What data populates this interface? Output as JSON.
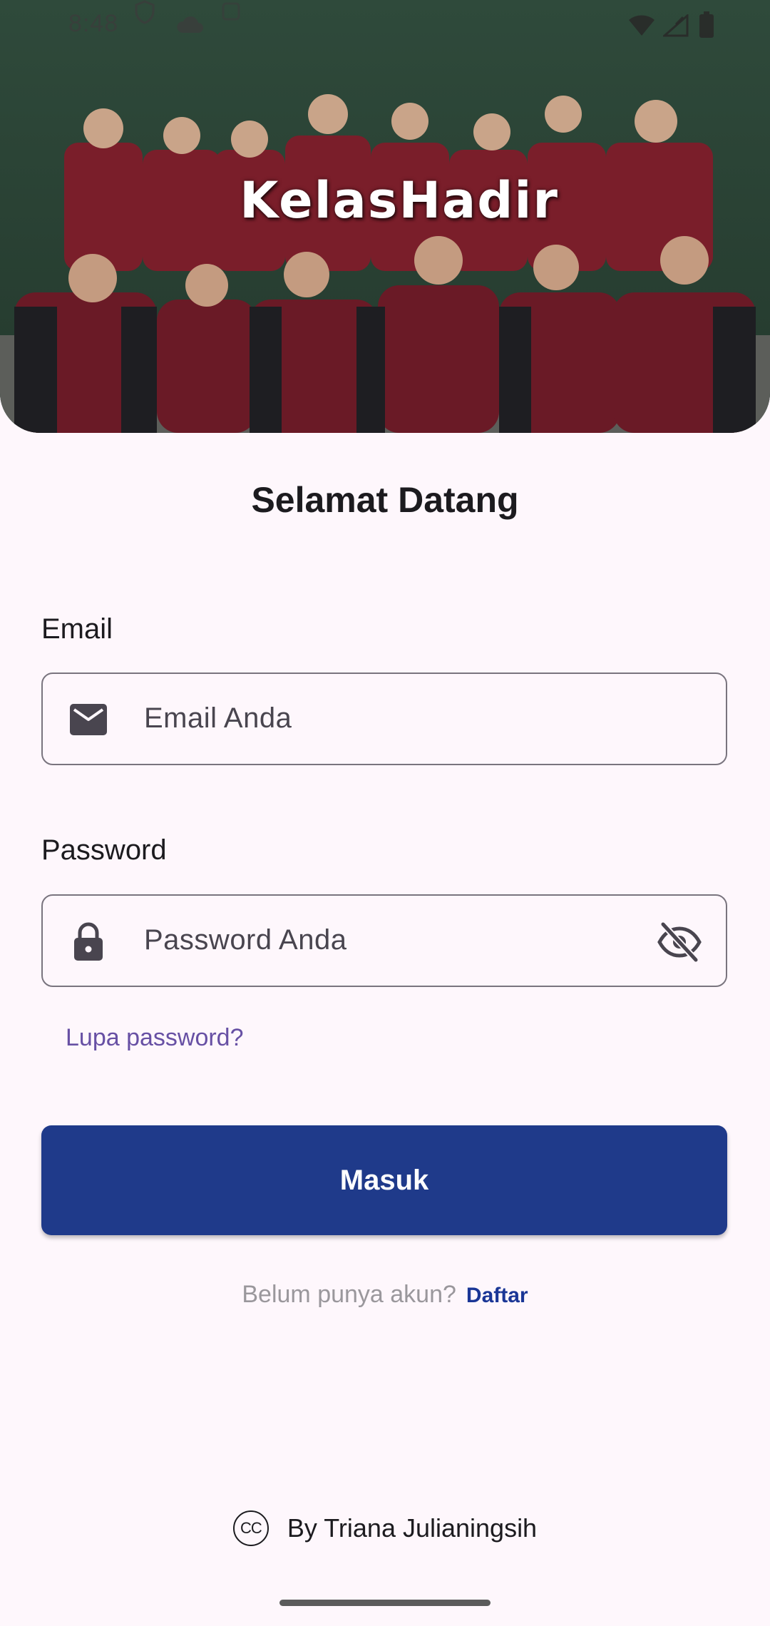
{
  "status_bar": {
    "time": "8:48"
  },
  "hero": {
    "brand": "KelasHadir"
  },
  "form": {
    "title": "Selamat Datang",
    "email": {
      "label": "Email",
      "placeholder": "Email Anda",
      "icon": "mail-icon"
    },
    "password": {
      "label": "Password",
      "placeholder": "Password Anda",
      "icon": "lock-icon",
      "toggle_icon": "visibility-off-icon"
    },
    "forgot_link": "Lupa password?",
    "submit_label": "Masuk",
    "signup_prompt": "Belum punya akun?",
    "signup_link": "Daftar"
  },
  "footer": {
    "cc_symbol": "CC",
    "credit": "By Triana Julianingsih"
  },
  "colors": {
    "background": "#fef7fc",
    "primary_button": "#1f3a8a",
    "link": "#6750a4",
    "signup_link": "#1a3696"
  }
}
